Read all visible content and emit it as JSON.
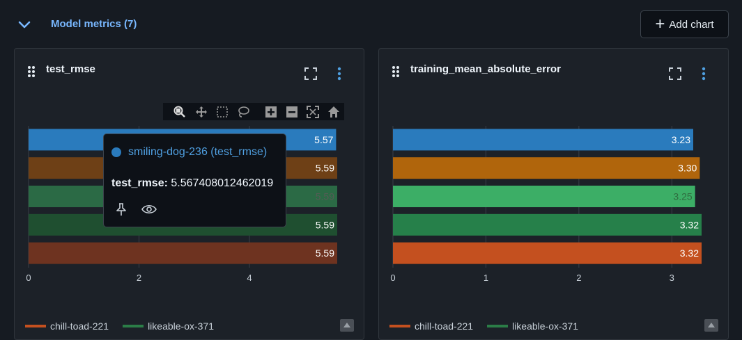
{
  "section": {
    "title": "Model metrics (7)",
    "add_chart_label": "Add chart"
  },
  "toolbar_icons": [
    "zoom-icon",
    "pan-icon",
    "box-select-icon",
    "lasso-icon",
    "zoom-in-icon",
    "zoom-out-icon",
    "autoscale-icon",
    "reset-home-icon"
  ],
  "legend": [
    {
      "name": "chill-toad-221",
      "color": "#c4501f"
    },
    {
      "name": "likeable-ox-371",
      "color": "#2b7d47"
    }
  ],
  "tooltip": {
    "run": "smiling-dog-236 (test_rmse)",
    "metric_label": "test_rmse:",
    "metric_value": "5.567408012462019"
  },
  "charts": [
    {
      "title": "test_rmse",
      "chart_data": {
        "type": "bar",
        "orientation": "horizontal",
        "values": [
          5.57,
          5.59,
          5.59,
          5.59,
          5.59
        ],
        "labels": [
          "5.57",
          "5.59",
          "5.59",
          "5.59",
          "5.59"
        ],
        "colors": [
          "#2a7bbd",
          "#6e4016",
          "#2b6a45",
          "#1f4f30",
          "#6e3320"
        ],
        "label_colors": [
          "#ffffff",
          "#ffffff",
          "#555b55",
          "#ffffff",
          "#ffffff"
        ],
        "xticks": [
          0,
          2,
          4
        ],
        "xlim": [
          0,
          5.59
        ],
        "grid": true
      }
    },
    {
      "title": "training_mean_absolute_error",
      "chart_data": {
        "type": "bar",
        "orientation": "horizontal",
        "values": [
          3.23,
          3.3,
          3.25,
          3.32,
          3.32
        ],
        "labels": [
          "3.23",
          "3.30",
          "3.25",
          "3.32",
          "3.32"
        ],
        "colors": [
          "#2a7bbd",
          "#b0650c",
          "#3cae66",
          "#26804a",
          "#c4501f"
        ],
        "label_colors": [
          "#ffffff",
          "#ffffff",
          "#2f6b3f",
          "#ffffff",
          "#ffffff"
        ],
        "xticks": [
          0,
          1,
          2,
          3
        ],
        "xlim": [
          0,
          3.32
        ],
        "grid": true
      }
    }
  ]
}
